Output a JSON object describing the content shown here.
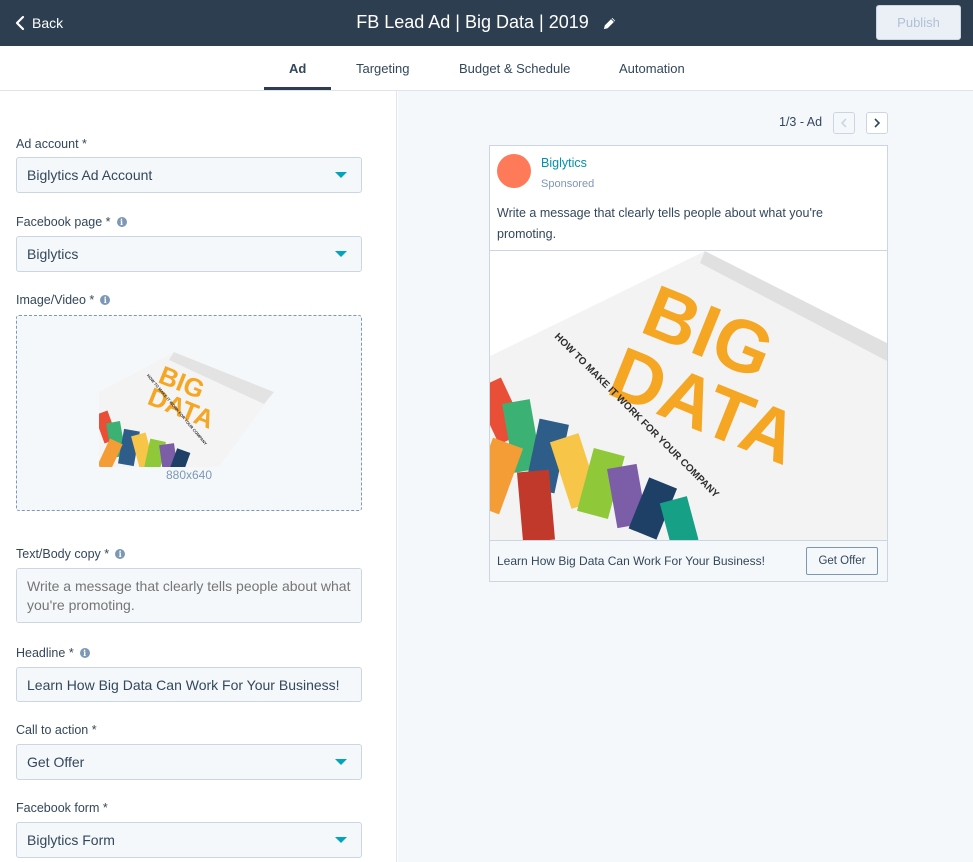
{
  "header": {
    "back_label": "Back",
    "title": "FB Lead Ad | Big Data | 2019",
    "publish_label": "Publish"
  },
  "tabs": [
    {
      "label": "Ad",
      "active": true
    },
    {
      "label": "Targeting",
      "active": false
    },
    {
      "label": "Budget & Schedule",
      "active": false
    },
    {
      "label": "Automation",
      "active": false
    }
  ],
  "form": {
    "ad_account": {
      "label": "Ad account *",
      "value": "Biglytics Ad Account"
    },
    "facebook_page": {
      "label": "Facebook page *",
      "value": "Biglytics"
    },
    "image_video": {
      "label": "Image/Video *",
      "dimensions": "880x640",
      "book_title_line1": "BIG",
      "book_title_line2": "DATA",
      "book_subtitle": "HOW TO MAKE IT WORK FOR YOUR COMPANY"
    },
    "body_copy": {
      "label": "Text/Body copy *",
      "placeholder": "Write a message that clearly tells people about what you're promoting."
    },
    "headline": {
      "label": "Headline *",
      "value": "Learn How Big Data Can Work For Your Business!"
    },
    "call_to_action": {
      "label": "Call to action *",
      "value": "Get Offer"
    },
    "facebook_form": {
      "label": "Facebook form *",
      "value": "Biglytics Form"
    }
  },
  "preview": {
    "pager_text": "1/3 - Ad",
    "page_name": "Biglytics",
    "sponsored": "Sponsored",
    "message": "Write a message that clearly tells people about what you're promoting.",
    "book_title_line1": "BIG",
    "book_title_line2": "DATA",
    "book_subtitle": "HOW TO MAKE IT WORK FOR YOUR COMPANY",
    "headline": "Learn How Big Data Can Work For Your Business!",
    "cta_label": "Get Offer"
  },
  "colors": {
    "topbar": "#2d3e50",
    "accent": "#00a4bd",
    "avatar": "#ff7a59",
    "book_orange": "#f5a623"
  },
  "icons": {
    "back": "chevron-left-icon",
    "edit": "pencil-icon",
    "info": "info-icon",
    "dropdown": "caret-down-icon",
    "prev": "chevron-left-icon",
    "next": "chevron-right-icon"
  }
}
